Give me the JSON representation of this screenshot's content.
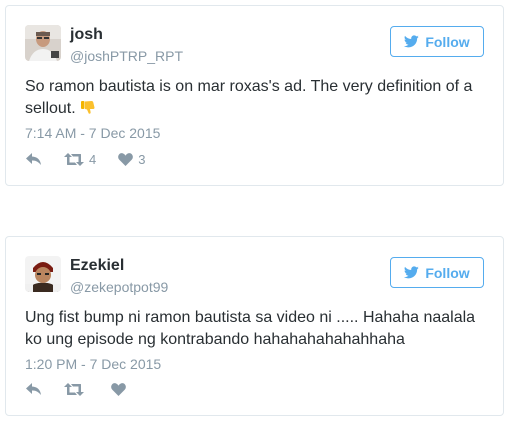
{
  "tweets": [
    {
      "display_name": "josh",
      "handle": "@joshPTRP_RPT",
      "follow_label": "Follow",
      "text": "So ramon bautista is on mar roxas's ad. The very definition of a sellout.",
      "emoji": "thumbs-down",
      "timestamp": "7:14 AM - 7 Dec 2015",
      "retweets": "4",
      "likes": "3",
      "avatar": "person-photo-avatar"
    },
    {
      "display_name": "Ezekiel",
      "handle": "@zekepotpot99",
      "follow_label": "Follow",
      "text": "Ung fist bump ni ramon bautista sa video ni ..... Hahaha naalala ko ung episode ng kontrabando hahahahahahahhaha",
      "timestamp": "1:20 PM - 7 Dec 2015",
      "retweets": "",
      "likes": "",
      "avatar": "character-avatar"
    }
  ],
  "colors": {
    "accent": "#55acee",
    "muted": "#8899a6",
    "text": "#292f33",
    "border": "#e1e8ed"
  }
}
